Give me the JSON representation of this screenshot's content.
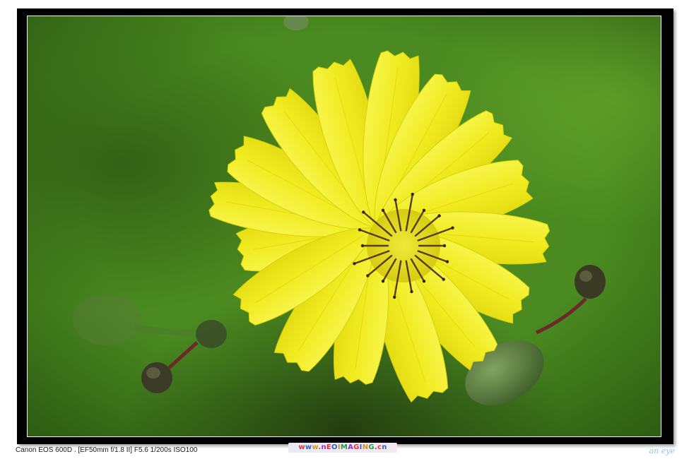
{
  "caption": {
    "camera_info": "Canon EOS 600D . [EF50mm f/1.8 II] F5.6 1/200s ISO100"
  },
  "watermark": {
    "text": "www.nEOIMAGING.cn",
    "colors": [
      "#e0303a",
      "#2a5fd0",
      "#d98c1f",
      "#1f9a46",
      "#8a2fc0"
    ]
  },
  "signature": {
    "text": "an eye"
  },
  "photo": {
    "subject": "yellow-flower",
    "colors": {
      "background_light": "#5e9a26",
      "background_dark": "#1d3a0e",
      "petal": "#f3ef2a",
      "petal_edge": "#d9d20a",
      "center": "#e9e31c",
      "stamen": "#5a3a12",
      "stem": "#6a2a2a",
      "bud": "#5e7a3a"
    }
  }
}
